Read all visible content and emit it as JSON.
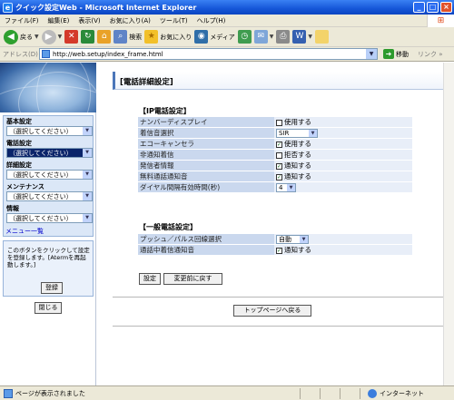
{
  "window": {
    "title": "クイック設定Web - Microsoft Internet Explorer",
    "icon": "ie-page-icon",
    "buttons": [
      "_",
      "□",
      "×"
    ]
  },
  "menu": [
    "ファイル(F)",
    "編集(E)",
    "表示(V)",
    "お気に入り(A)",
    "ツール(T)",
    "ヘルプ(H)"
  ],
  "toolbar": {
    "back": "戻る",
    "search": "検索",
    "favorites": "お気に入り",
    "media": "メディア"
  },
  "address": {
    "label": "アドレス(D)",
    "url": "http://web.setup/index_frame.html",
    "go": "移動",
    "links": "リンク »"
  },
  "sidebar": {
    "groups": [
      {
        "label": "基本設定",
        "value": "（選択してください）",
        "selected": false
      },
      {
        "label": "電話設定",
        "value": "（選択してください）",
        "selected": true
      },
      {
        "label": "詳細設定",
        "value": "（選択してください）",
        "selected": false
      },
      {
        "label": "メンテナンス",
        "value": "（選択してください）",
        "selected": false
      },
      {
        "label": "情報",
        "value": "（選択してください）",
        "selected": false
      }
    ],
    "menu_link": "メニュー一覧",
    "help_text": "このボタンをクリックして設定を登録します。[Atermを再起動します。]",
    "register_button": "登録",
    "close_button": "閉じる"
  },
  "main": {
    "page_title": "[電話詳細設定]",
    "ip_section": {
      "title": "【IP電話設定】",
      "rows": [
        {
          "label": "ナンバーディスプレイ",
          "type": "checkbox",
          "checked": false,
          "text": "使用する"
        },
        {
          "label": "着信音選択",
          "type": "select",
          "value": "SIR"
        },
        {
          "label": "エコーキャンセラ",
          "type": "checkbox",
          "checked": true,
          "text": "使用する"
        },
        {
          "label": "非通知着信",
          "type": "checkbox",
          "checked": false,
          "text": "拒否する"
        },
        {
          "label": "発信者情報",
          "type": "checkbox",
          "checked": true,
          "text": "通知する"
        },
        {
          "label": "無料通話通知音",
          "type": "checkbox",
          "checked": true,
          "text": "通知する"
        },
        {
          "label": "ダイヤル間隔有効時間(秒)",
          "type": "select",
          "value": "4"
        }
      ]
    },
    "general_section": {
      "title": "【一般電話設定】",
      "rows": [
        {
          "label": "プッシュ／パルス回線選択",
          "type": "select",
          "value": "自動"
        },
        {
          "label": "通話中着信通知音",
          "type": "checkbox",
          "checked": true,
          "text": "通知する"
        }
      ]
    },
    "set_button": "設定",
    "revert_button": "変更前に戻す",
    "top_button": "トップページへ戻る"
  },
  "status": {
    "text": "ページが表示されました",
    "zone": "インターネット"
  },
  "colors": {
    "titlebar": "#1556d8",
    "label_cell": "#cad8ee",
    "control_cell": "#e8eef8",
    "nav_panel": "#dbe7f7"
  }
}
